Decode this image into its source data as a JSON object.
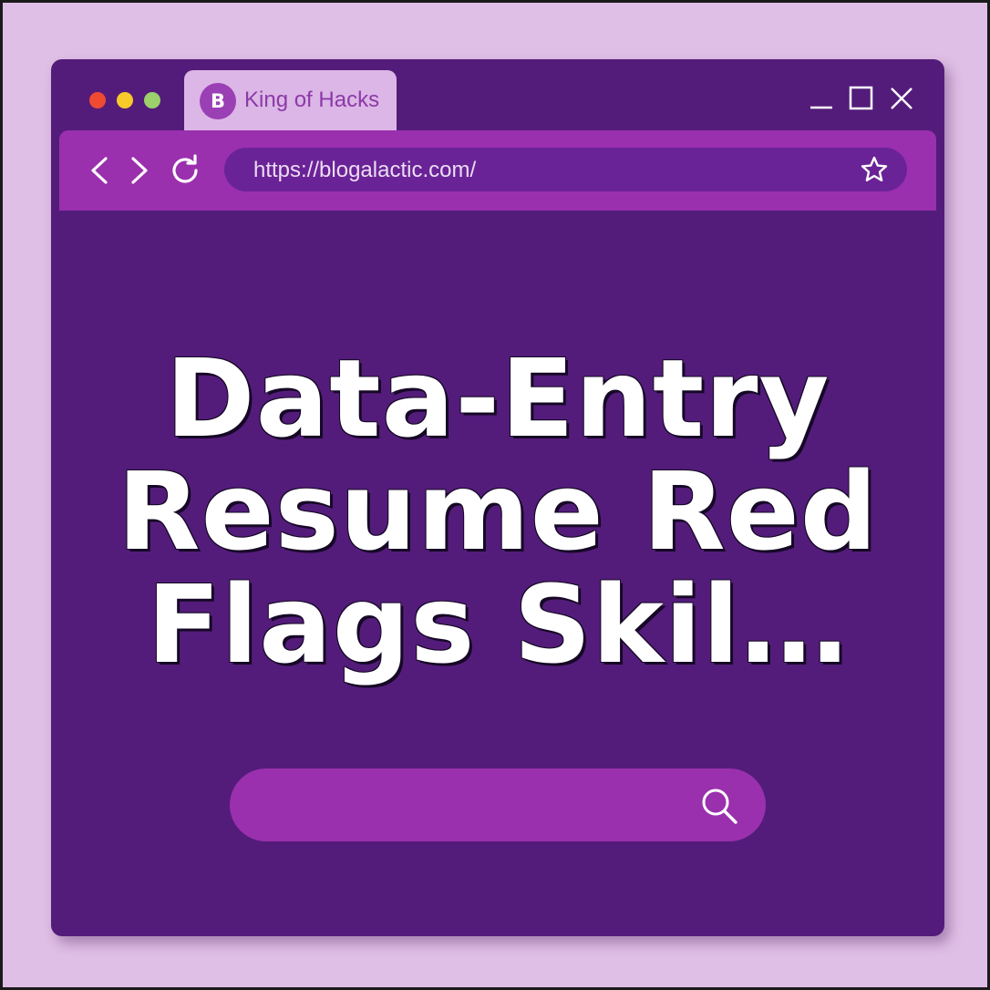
{
  "window": {
    "tab": {
      "avatar_letter": "B",
      "title": "King of Hacks"
    },
    "controls": [
      "minimize-icon",
      "maximize-icon",
      "close-icon"
    ]
  },
  "toolbar": {
    "nav_icons": [
      "chevron-left-icon",
      "chevron-right-icon",
      "reload-icon"
    ],
    "url": "https://blogalactic.com/",
    "bookmark_icon": "star-icon"
  },
  "main": {
    "headline": "Data-Entry Resume Red Flags Skil…",
    "search": {
      "placeholder": "",
      "icon": "search-icon"
    }
  },
  "colors": {
    "page_background": "#e0bfe6",
    "window_background": "#531c7a",
    "toolbar": "#9a30ad",
    "url_bar": "#6a2396",
    "tab": "#dcb6e6",
    "tab_text": "#8b3aa8",
    "traffic_red": "#f04b32",
    "traffic_yellow": "#f7c92a",
    "traffic_green": "#9bd06a",
    "headline_text": "#ffffff"
  }
}
